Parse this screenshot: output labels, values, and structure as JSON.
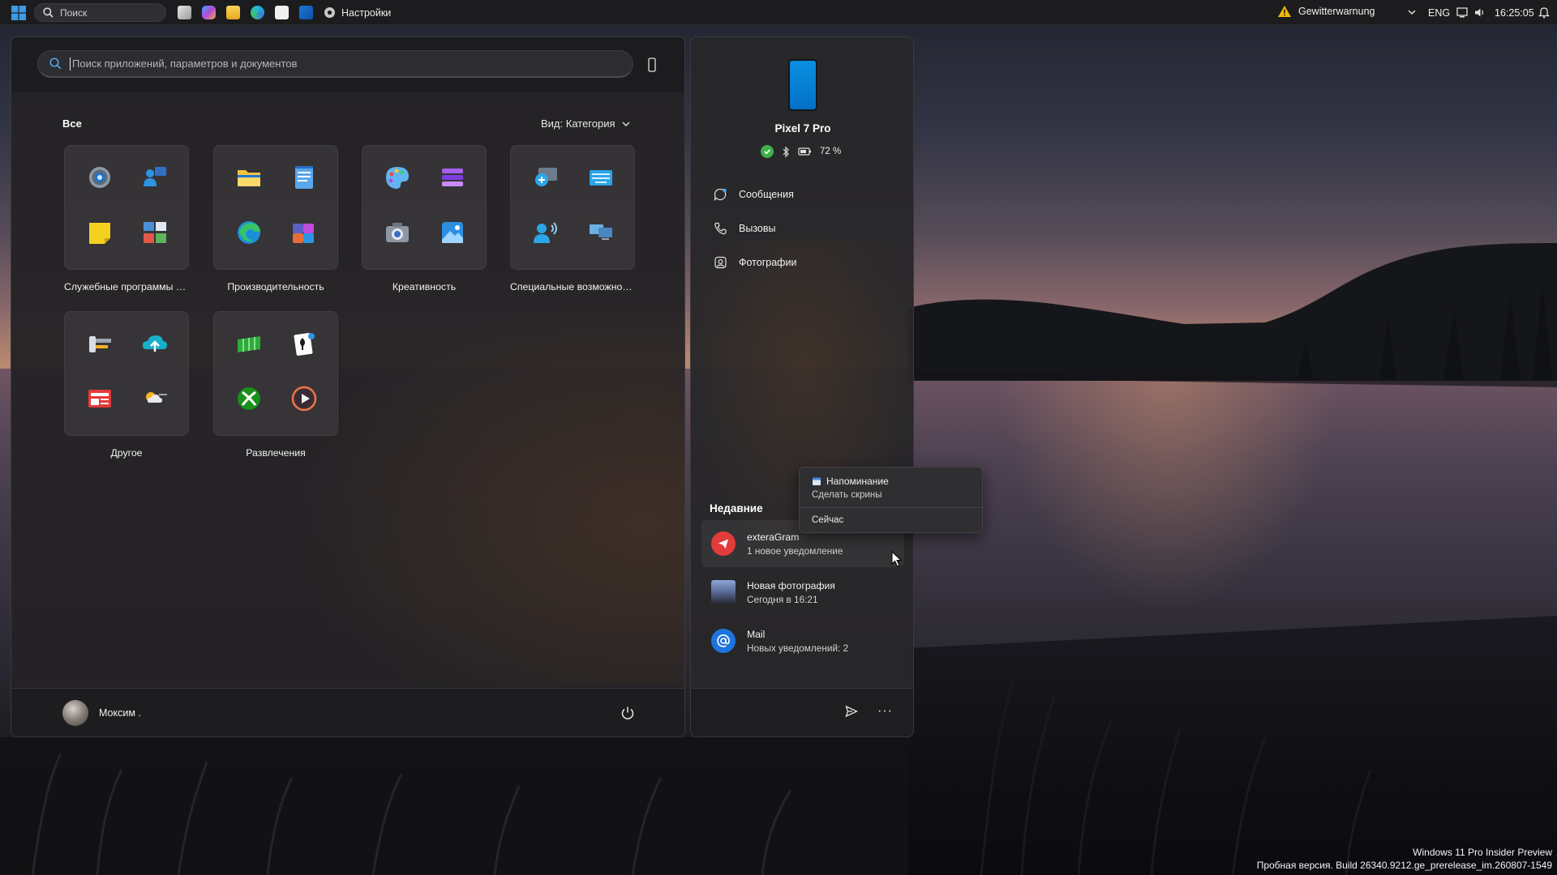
{
  "taskbar": {
    "search_label": "Поиск",
    "active_app_label": "Настройки",
    "weather_label": "Gewitterwarnung",
    "language": "ENG",
    "clock": "16:25:05"
  },
  "start_menu": {
    "search_placeholder": "Поиск приложений, параметров и документов",
    "section_label": "Все",
    "view_label": "Вид: Категория",
    "folders": [
      {
        "name": "Служебные программы и...",
        "icons": [
          "settings-icon",
          "people-icon",
          "sticky-notes-icon",
          "control-panel-icon"
        ]
      },
      {
        "name": "Производительность",
        "icons": [
          "file-explorer-icon",
          "notepad-icon",
          "edge-icon",
          "teams-icon"
        ]
      },
      {
        "name": "Креативность",
        "icons": [
          "paint-icon",
          "clipchamp-icon",
          "camera-icon",
          "photos-icon"
        ]
      },
      {
        "name": "Специальные возможнос...",
        "icons": [
          "magnifier-icon",
          "on-screen-keyboard-icon",
          "narrator-icon",
          "remote-desktop-icon"
        ]
      },
      {
        "name": "Другое",
        "icons": [
          "dev-tools-icon",
          "onedrive-icon",
          "news-icon",
          "weather-icon"
        ]
      },
      {
        "name": "Развлечения",
        "icons": [
          "solitaire-board-icon",
          "solitaire-cards-icon",
          "xbox-icon",
          "media-player-icon"
        ]
      }
    ],
    "user_name": "Моксим ."
  },
  "phone_panel": {
    "device_name": "Pixel 7 Pro",
    "battery": "72 %",
    "links": [
      {
        "label": "Сообщения"
      },
      {
        "label": "Вызовы"
      },
      {
        "label": "Фотографии"
      }
    ],
    "recent_label": "Недавние",
    "recent": [
      {
        "title": "exteraGram",
        "subtitle": "1 новое уведомление"
      },
      {
        "title": "Новая фотография",
        "subtitle": "Сегодня в 16:21"
      },
      {
        "title": "Mail",
        "subtitle": "Новых уведомлений: 2"
      }
    ]
  },
  "popup": {
    "title": "Напоминание",
    "subtitle": "Сделать скрины",
    "time": "Сейчас"
  },
  "watermark": {
    "line1": "Windows 11 Pro Insider Preview",
    "line2": "Пробная версия. Build 26340.9212.ge_prerelease_im.260807-1549"
  },
  "colors": {
    "accent": "#0a8fe0",
    "panel": "#242225",
    "status_ok": "#3fb14a"
  }
}
